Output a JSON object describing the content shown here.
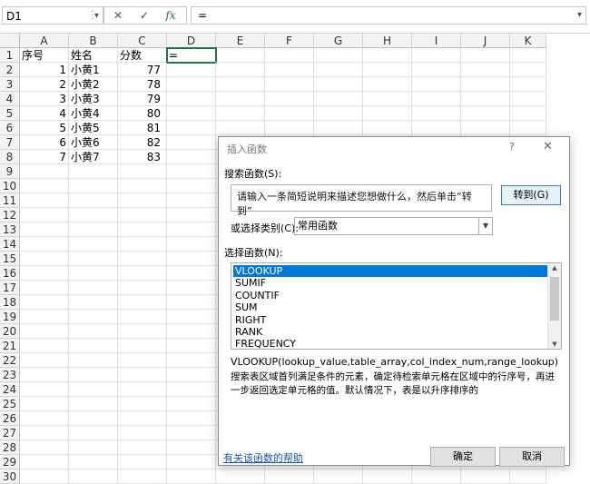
{
  "formula_bar": {
    "name_box": "D1",
    "separator": "⋮",
    "cancel_icon": "✕",
    "enter_icon": "✓",
    "fx_label": "fx",
    "formula": "="
  },
  "columns": [
    "A",
    "B",
    "C",
    "D",
    "E",
    "F",
    "G",
    "H",
    "I",
    "J",
    "K"
  ],
  "rows": [
    "1",
    "2",
    "3",
    "4",
    "5",
    "6",
    "7",
    "8",
    "9",
    "10",
    "11",
    "12",
    "13",
    "14",
    "15",
    "16",
    "17",
    "18",
    "19",
    "20",
    "21",
    "22",
    "23",
    "24",
    "25",
    "26",
    "27",
    "28",
    "29",
    "30"
  ],
  "cells": {
    "header": {
      "a": "序号",
      "b": "姓名",
      "c": "分数",
      "d": "="
    },
    "data": [
      {
        "a": "1",
        "b": "小黄1",
        "c": "77"
      },
      {
        "a": "2",
        "b": "小黄2",
        "c": "78"
      },
      {
        "a": "3",
        "b": "小黄3",
        "c": "79"
      },
      {
        "a": "4",
        "b": "小黄4",
        "c": "80"
      },
      {
        "a": "5",
        "b": "小黄5",
        "c": "81"
      },
      {
        "a": "6",
        "b": "小黄6",
        "c": "82"
      },
      {
        "a": "7",
        "b": "小黄7",
        "c": "83"
      }
    ]
  },
  "dialog": {
    "title": "插入函数",
    "help_label": "?",
    "close_label": "✕",
    "search_label": "搜索函数(S):",
    "search_placeholder": "请输入一条简短说明来描述您想做什么，然后单击“转到”",
    "goto_label": "转到(G)",
    "category_label": "或选择类别(C):",
    "category_value": "常用函数",
    "select_label": "选择函数(N):",
    "functions": [
      "VLOOKUP",
      "SUMIF",
      "COUNTIF",
      "SUM",
      "RIGHT",
      "RANK",
      "FREQUENCY"
    ],
    "syntax": "VLOOKUP(lookup_value,table_array,col_index_num,range_lookup)",
    "description": "搜索表区域首列满足条件的元素，确定待检索单元格在区域中的行序号，再进一步返回选定单元格的值。默认情况下，表是以升序排序的",
    "help_link": "有关该函数的帮助",
    "ok_label": "确定",
    "cancel_label": "取消"
  }
}
